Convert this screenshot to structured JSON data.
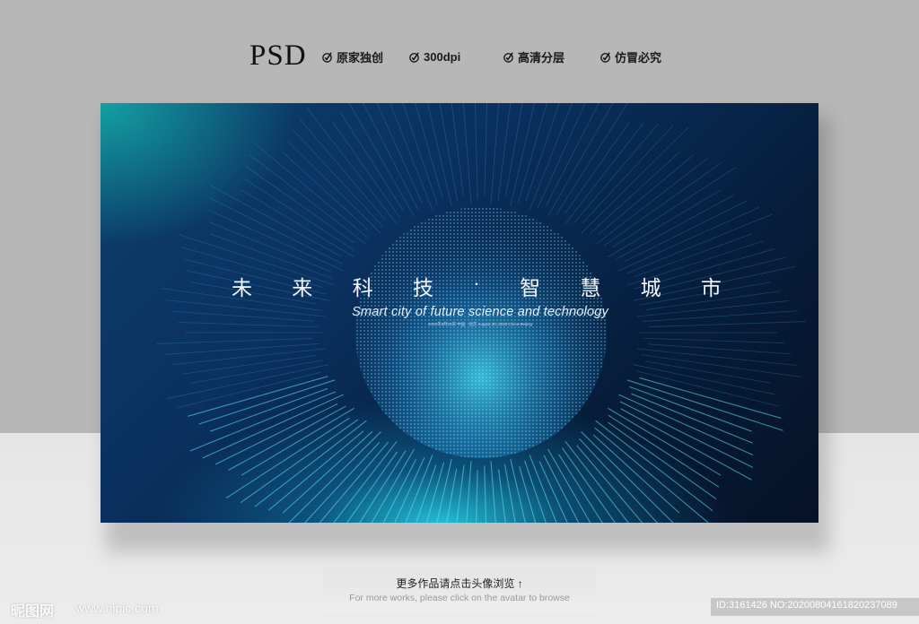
{
  "header": {
    "psd_label": "PSD",
    "features": [
      {
        "label": "原家独创",
        "icon": "check-badge-icon"
      },
      {
        "label": "300dpi",
        "icon": "check-badge-icon"
      },
      {
        "label": "高清分层",
        "icon": "check-badge-icon"
      },
      {
        "label": "仿冒必究",
        "icon": "check-badge-icon"
      }
    ]
  },
  "banner": {
    "title_chars": [
      "未",
      "来",
      "科",
      "技",
      "·",
      "智",
      "慧",
      "城",
      "市"
    ],
    "subtitle": "Smart city of future science and technology",
    "date_line": "2020年8月20日 中国 · 北京    August 20, 2020 China Beijing",
    "colors": {
      "glow": "#28dcf0",
      "deep": "#061226",
      "accent": "#0d3f6c"
    }
  },
  "caption": {
    "chinese": "更多作品请点击头像浏览 ↑",
    "english": "For more works, please click on the avatar to browse"
  },
  "watermark": {
    "logo_text": "昵图网",
    "url": "www.nipic.com",
    "id_text": "ID:3161426 NO:20200804161820237089"
  }
}
